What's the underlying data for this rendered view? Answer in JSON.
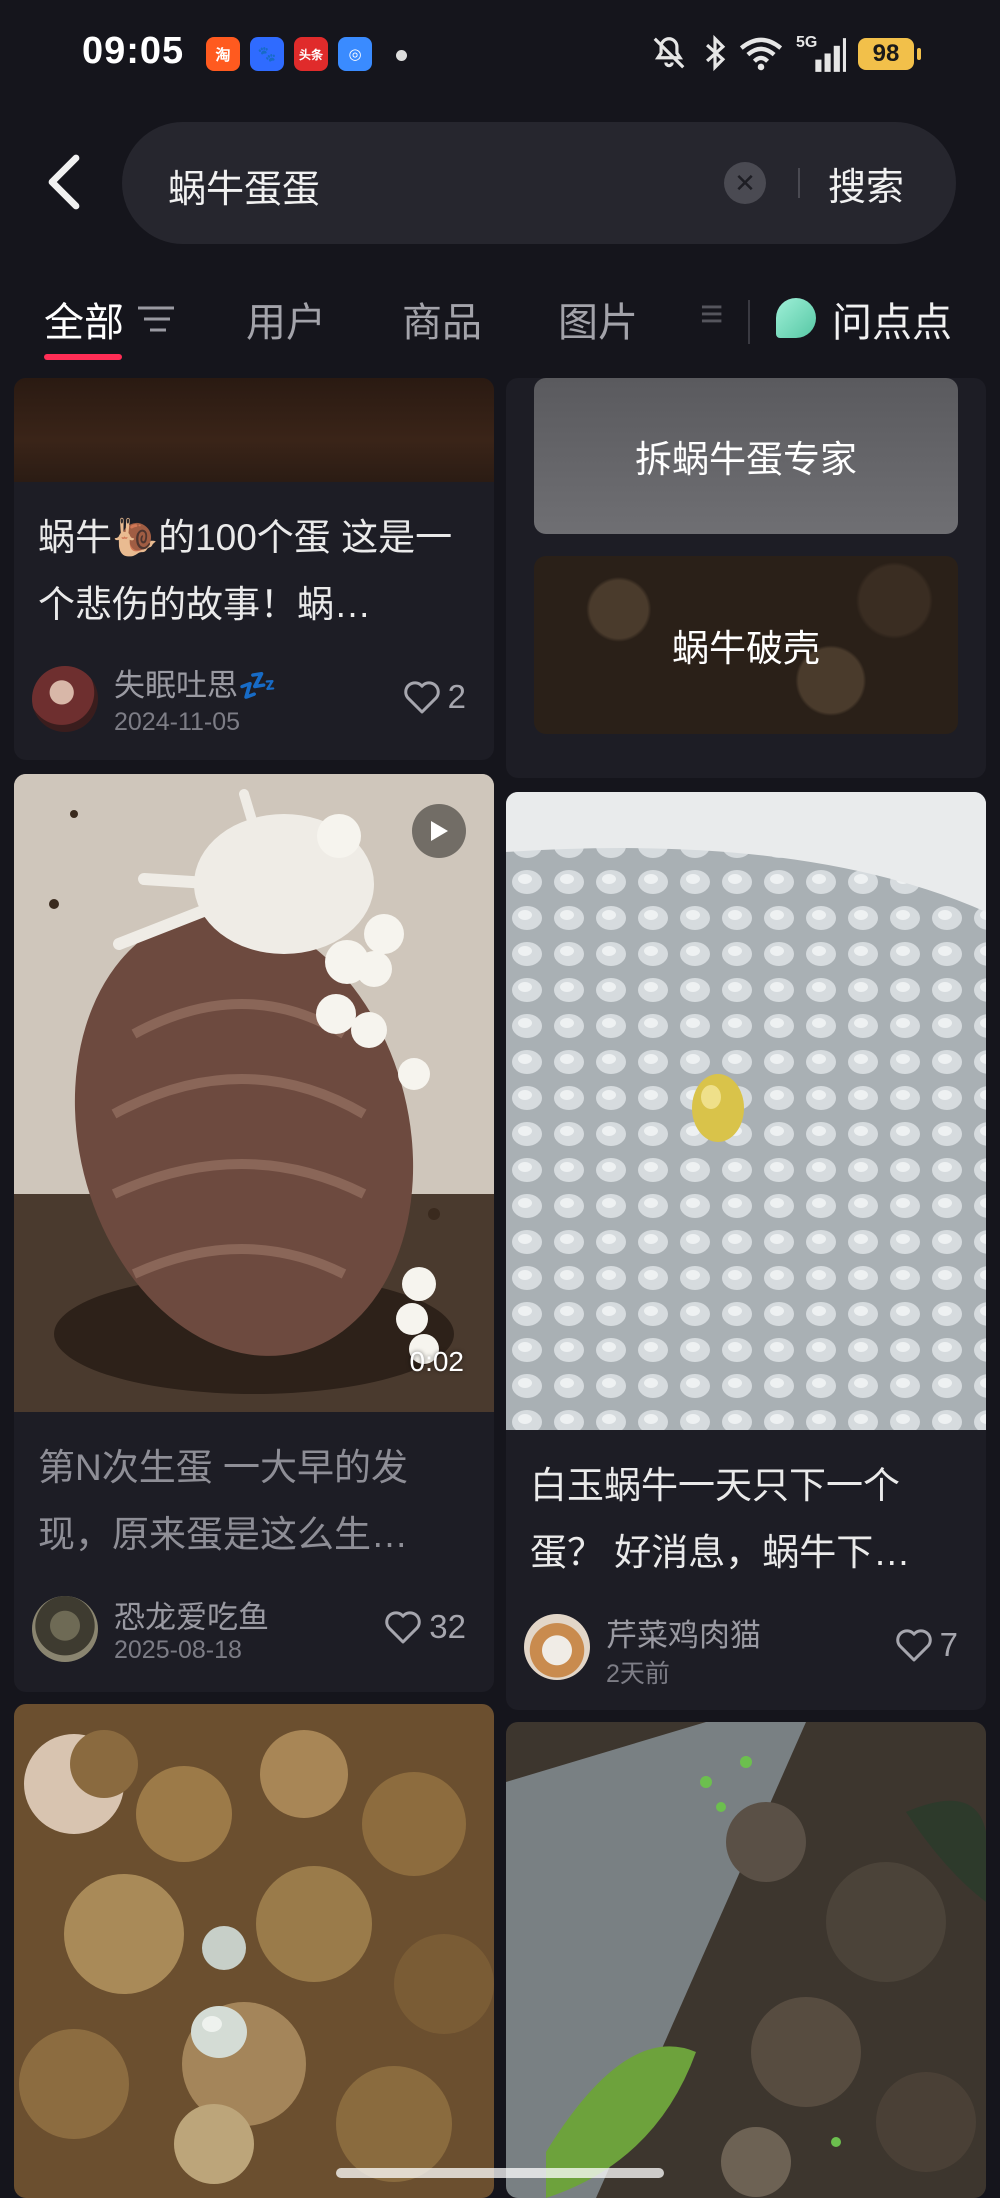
{
  "status_bar": {
    "time": "09:05",
    "apps": [
      {
        "label": "淘",
        "color": "#ff5a1f"
      },
      {
        "label": "🐾",
        "color": "#2f6bff"
      },
      {
        "label": "头条",
        "color": "#e02b2b"
      },
      {
        "label": "◎",
        "color": "#3a8bff"
      }
    ],
    "signal": "5G",
    "battery": "98"
  },
  "search": {
    "query": "蜗牛蛋蛋",
    "button": "搜索"
  },
  "tabs": {
    "items": [
      "全部",
      "用户",
      "商品",
      "图片"
    ],
    "overflow_char": "≡",
    "wen_label": "问点点"
  },
  "posts": {
    "left1": {
      "title": "蜗牛🐌的100个蛋 这是一个悲伤的故事！蜗…",
      "author": "失眠吐思💤",
      "date": "2024-11-05",
      "likes": "2"
    },
    "left2": {
      "title": "第N次生蛋 一大早的发现，原来蛋是这么生…",
      "author": "恐龙爱吃鱼",
      "date": "2025-08-18",
      "likes": "32",
      "duration": "0:02"
    },
    "right2": {
      "title": "白玉蜗牛一天只下一个蛋？ 好消息，蜗牛下…",
      "author": "芹菜鸡肉猫",
      "date": "2天前",
      "likes": "7"
    }
  },
  "topics": {
    "t1": "拆蜗牛蛋专家",
    "t2": "蜗牛破壳"
  }
}
